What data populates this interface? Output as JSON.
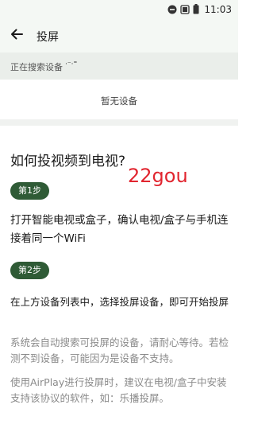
{
  "status_bar": {
    "time": "11:03",
    "icons": [
      "do-not-disturb-icon",
      "battery-saver-icon",
      "battery-icon"
    ]
  },
  "app_bar": {
    "title": "投屏",
    "back_icon": "arrow-back-icon"
  },
  "search": {
    "status_text": "正在搜索设备",
    "dots": "·⁻·⁼"
  },
  "device_list": {
    "empty_text": "暂无设备"
  },
  "help": {
    "title": "如何投视频到电视?",
    "watermark": "22gou",
    "steps": [
      {
        "badge": "第1步",
        "text": "打开智能电视或盒子，确认电视/盒子与手机连接着同一个WiFi"
      },
      {
        "badge": "第2步",
        "text": "在上方设备列表中，选择投屏设备，即可开始投屏"
      }
    ],
    "notes": [
      "系统会自动搜索可投屏的设备，请耐心等待。若检测不到设备，可能因为是设备不支持。",
      "使用AirPlay进行投屏时，建议在电视/盒子中安装支持该协议的软件，如：乐播投屏。"
    ]
  },
  "colors": {
    "accent": "#2f5b36",
    "watermark": "#e1252f",
    "app_bar_bg": "#f4f8f4",
    "search_strip_bg": "#eaeeea"
  }
}
